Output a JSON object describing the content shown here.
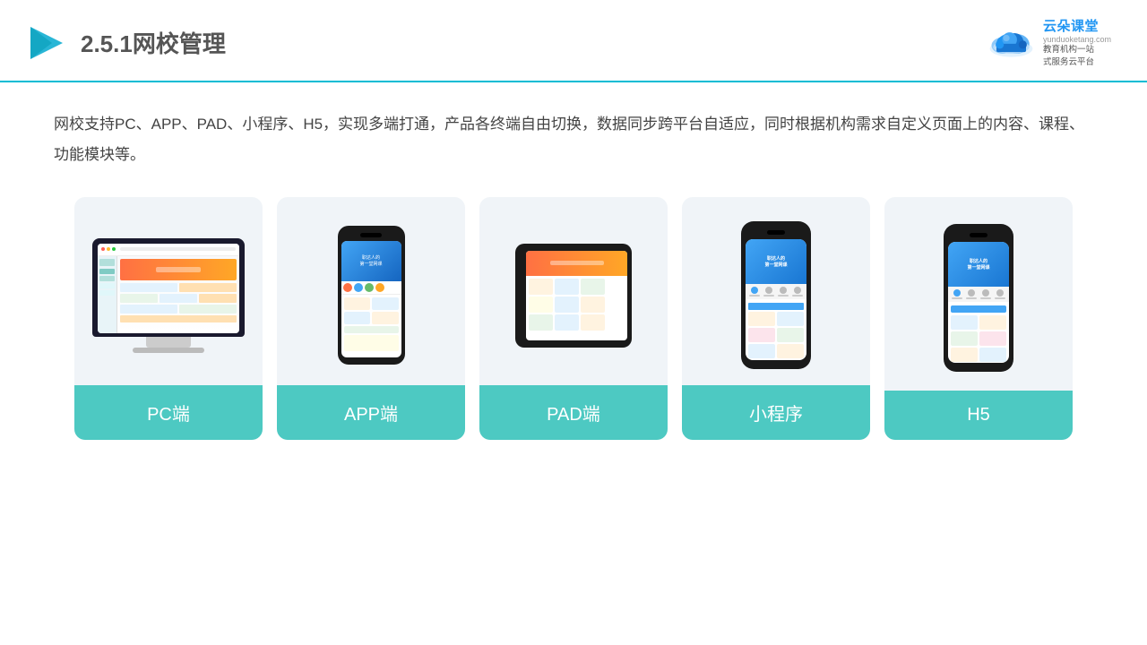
{
  "header": {
    "title_prefix": "2.5.1",
    "title_main": "网校管理",
    "brand_name": "云朵课堂",
    "brand_url": "yunduoketang.com",
    "brand_slogan_line1": "教育机构一站",
    "brand_slogan_line2": "式服务云平台"
  },
  "description": {
    "text": "网校支持PC、APP、PAD、小程序、H5，实现多端打通，产品各终端自由切换，数据同步跨平台自适应，同时根据机构需求自定义页面上的内容、课程、功能模块等。"
  },
  "cards": [
    {
      "id": "pc",
      "label": "PC端"
    },
    {
      "id": "app",
      "label": "APP端"
    },
    {
      "id": "pad",
      "label": "PAD端"
    },
    {
      "id": "miniprogram",
      "label": "小程序"
    },
    {
      "id": "h5",
      "label": "H5"
    }
  ],
  "colors": {
    "teal": "#4dc9c2",
    "accent_blue": "#2196f3",
    "header_border": "#00bcd4"
  }
}
